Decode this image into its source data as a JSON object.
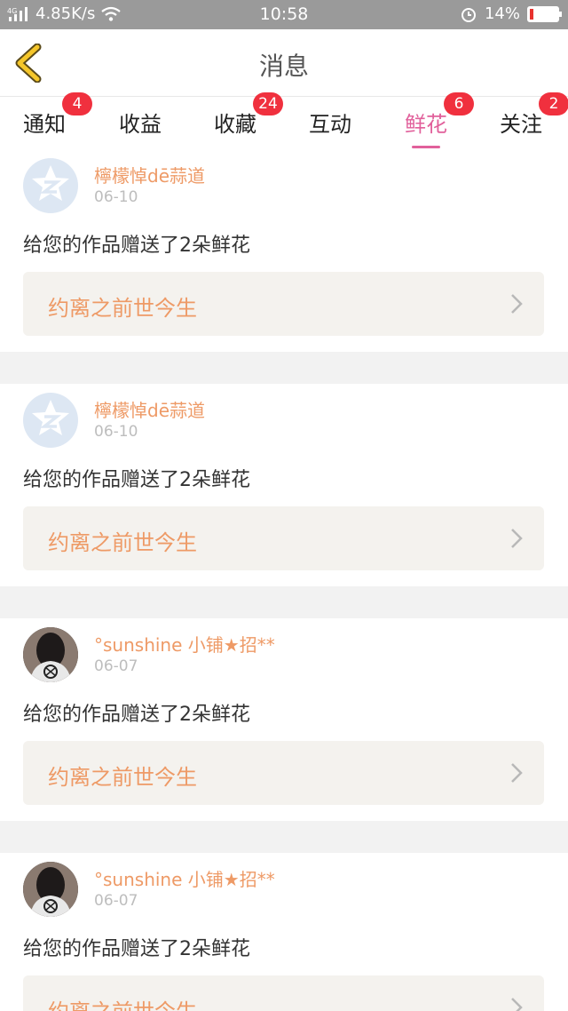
{
  "status_bar": {
    "network": "4G",
    "speed": "4.85K/s",
    "time": "10:58",
    "battery": "14%",
    "battery_level": 0.14
  },
  "header": {
    "title": "消息",
    "back_icon": "chevron-left-icon"
  },
  "tabs": [
    {
      "label": "通知",
      "badge": "4",
      "active": false
    },
    {
      "label": "收益",
      "badge": "",
      "active": false
    },
    {
      "label": "收藏",
      "badge": "24",
      "active": false
    },
    {
      "label": "互动",
      "badge": "",
      "active": false
    },
    {
      "label": "鲜花",
      "badge": "6",
      "active": true
    },
    {
      "label": "关注",
      "badge": "2",
      "active": false
    }
  ],
  "messages": [
    {
      "name": "檸檬悼dē蒜道",
      "date": "06-10",
      "text": "给您的作品赠送了2朵鲜花",
      "work": "约离之前世今生",
      "avatar": "default-avatar"
    },
    {
      "name": "檸檬悼dē蒜道",
      "date": "06-10",
      "text": "给您的作品赠送了2朵鲜花",
      "work": "约离之前世今生",
      "avatar": "default-avatar"
    },
    {
      "name": "°sunshine 小铺★招**",
      "date": "06-07",
      "text": "给您的作品赠送了2朵鲜花",
      "work": "约离之前世今生",
      "avatar": "photo-avatar"
    },
    {
      "name": "°sunshine 小铺★招**",
      "date": "06-07",
      "text": "给您的作品赠送了2朵鲜花",
      "work": "约离之前世今生",
      "avatar": "photo-avatar"
    }
  ],
  "colors": {
    "accent": "#e1609b",
    "badge": "#f0303e",
    "name": "#ee9a66",
    "back_arrow": "#f5c62a"
  }
}
